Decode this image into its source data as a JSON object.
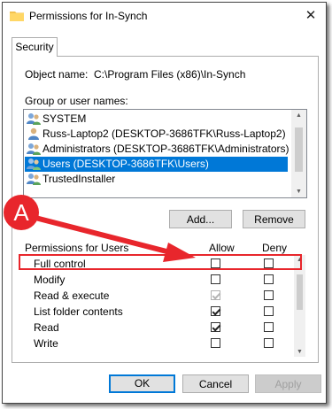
{
  "window": {
    "title": "Permissions for In-Synch",
    "close_glyph": "✕"
  },
  "tabs": [
    {
      "label": "Security"
    }
  ],
  "object": {
    "label": "Object name:",
    "value": "C:\\Program Files (x86)\\In-Synch"
  },
  "groups": {
    "label": "Group or user names:",
    "items": [
      {
        "name": "SYSTEM",
        "icon": "users-icon",
        "selected": false
      },
      {
        "name": "Russ-Laptop2 (DESKTOP-3686TFK\\Russ-Laptop2)",
        "icon": "user-icon",
        "selected": false
      },
      {
        "name": "Administrators (DESKTOP-3686TFK\\Administrators)",
        "icon": "users-icon",
        "selected": false
      },
      {
        "name": "Users (DESKTOP-3686TFK\\Users)",
        "icon": "users-icon",
        "selected": true
      },
      {
        "name": "TrustedInstaller",
        "icon": "users-icon",
        "selected": false
      }
    ],
    "add_label": "Add...",
    "remove_label": "Remove"
  },
  "permissions": {
    "label": "Permissions for Users",
    "allow_header": "Allow",
    "deny_header": "Deny",
    "rows": [
      {
        "name": "Full control",
        "allow": false,
        "deny": false,
        "allow_disabled": false
      },
      {
        "name": "Modify",
        "allow": false,
        "deny": false,
        "allow_disabled": false
      },
      {
        "name": "Read & execute",
        "allow": true,
        "deny": false,
        "allow_disabled": true
      },
      {
        "name": "List folder contents",
        "allow": true,
        "deny": false,
        "allow_disabled": false
      },
      {
        "name": "Read",
        "allow": true,
        "deny": false,
        "allow_disabled": false
      },
      {
        "name": "Write",
        "allow": false,
        "deny": false,
        "allow_disabled": false
      }
    ]
  },
  "buttons": {
    "ok": "OK",
    "cancel": "Cancel",
    "apply": "Apply"
  },
  "annotation": {
    "letter": "A",
    "color": "#e8262c"
  },
  "colors": {
    "selection": "#0078d7"
  }
}
